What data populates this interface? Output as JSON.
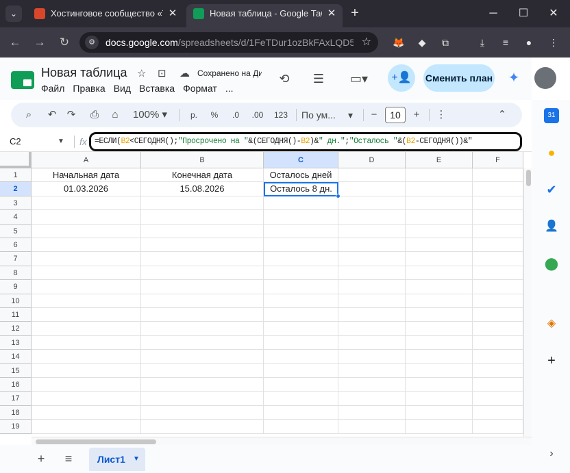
{
  "browser": {
    "tabs": [
      {
        "title": "Хостинговое сообщество «Tim",
        "active": false,
        "favicon_color": "#d9472b"
      },
      {
        "title": "Новая таблица - Google Табли",
        "active": true,
        "favicon_color": "#0f9d58"
      }
    ],
    "url_host": "docs.google.com",
    "url_path": "/spreadsheets/d/1FeTDur1ozBkFAxLQD5..."
  },
  "doc": {
    "title": "Новая таблица",
    "save_status": "Сохранено на Ди",
    "menu": [
      "Файл",
      "Правка",
      "Вид",
      "Вставка",
      "Формат",
      "..."
    ],
    "plan_button": "Сменить план"
  },
  "toolbar": {
    "zoom": "100%",
    "currency": "р.",
    "percent": "%",
    "decrease_decimals": ".0",
    "increase_decimals": ".00",
    "number_format": "123",
    "font": "По ум...",
    "font_size": "10"
  },
  "formula_bar": {
    "cell_ref": "C2",
    "fx": "fx",
    "parts": [
      {
        "text": "=ЕСЛИ(",
        "kind": "plain"
      },
      {
        "text": "B2",
        "kind": "ref"
      },
      {
        "text": "<СЕГОДНЯ();",
        "kind": "plain"
      },
      {
        "text": "\"Просрочено на \"",
        "kind": "str"
      },
      {
        "text": "&(СЕГОДНЯ()-",
        "kind": "plain"
      },
      {
        "text": "B2",
        "kind": "ref"
      },
      {
        "text": ")&",
        "kind": "plain"
      },
      {
        "text": "\" дн.\"",
        "kind": "str"
      },
      {
        "text": ";",
        "kind": "plain"
      },
      {
        "text": "\"Осталось \"",
        "kind": "str"
      },
      {
        "text": "&(",
        "kind": "plain"
      },
      {
        "text": "B2",
        "kind": "ref"
      },
      {
        "text": "-СЕГОДНЯ())&\"",
        "kind": "plain"
      }
    ]
  },
  "sheet": {
    "columns": [
      "A",
      "B",
      "C",
      "D",
      "E",
      "F"
    ],
    "rows": [
      "1",
      "2",
      "3",
      "4",
      "5",
      "6",
      "7",
      "8",
      "9",
      "10",
      "11",
      "12",
      "13",
      "14",
      "15",
      "16",
      "17",
      "18",
      "19"
    ],
    "cells": {
      "A1": "Начальная дата",
      "B1": "Конечная дата",
      "C1": "Осталось дней",
      "A2": "01.03.2026",
      "B2": "15.08.2026",
      "C2": "Осталось 8 дн."
    },
    "selected": "C2",
    "tab_name": "Лист1"
  },
  "colors": {
    "accent": "#1a73e8",
    "ref_color": "#e8a100",
    "string_color": "#188038",
    "sheets_green": "#0f9d58"
  }
}
